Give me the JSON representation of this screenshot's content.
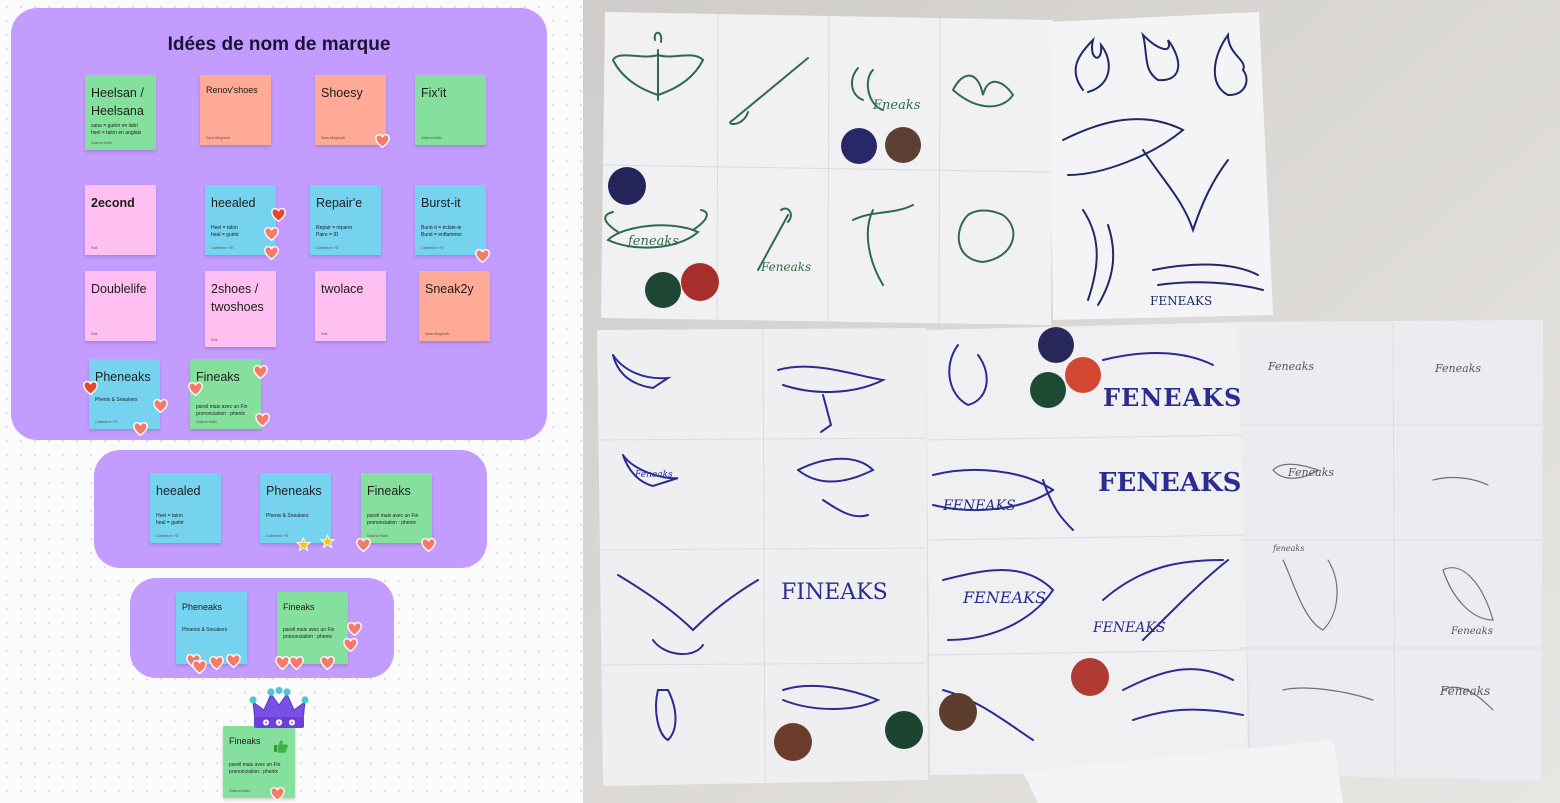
{
  "board": {
    "title": "Idées de nom de marque",
    "notes": [
      {
        "title": "Heelsan / Heelsana",
        "desc": "sana = guérir en latin\nheel = talon en anglais",
        "author": "Salima Mahi"
      },
      {
        "title": "Renov'shoes",
        "author": "Sara Meghreb"
      },
      {
        "title": "Shoesy",
        "author": "Sara Meghreb"
      },
      {
        "title": "Fix'it",
        "author": "Salima Mahi"
      },
      {
        "title": "2econd",
        "author": "Soli"
      },
      {
        "title": "heealed",
        "desc": "Heel = talon\nheal = guérir",
        "author": "Catherine YE"
      },
      {
        "title": "Repair'e",
        "desc": "Repair = réparer\nPaire = ID",
        "author": "Catherine YE"
      },
      {
        "title": "Burst-it",
        "desc": "Burst-it = éclate-le\nBurst = enflammer",
        "author": "Catherine YE"
      },
      {
        "title": "Doublelife",
        "author": "Soli"
      },
      {
        "title": "2shoes / twoshoes",
        "author": "Soli"
      },
      {
        "title": "twolace",
        "author": "Soli"
      },
      {
        "title": "Sneak2y",
        "author": "Sara Meghreb"
      },
      {
        "title": "Pheneaks",
        "desc": "Phenix & Sneakers",
        "author": "Catherine YE"
      },
      {
        "title": "Fineaks",
        "desc": "pareil mais avec un Fin prononciation : phenix",
        "author": "Salima Mahi"
      }
    ],
    "finalists": [
      {
        "title": "heealed",
        "desc": "Heel = talon\nheal = guérir",
        "author": "Catherine YE"
      },
      {
        "title": "Pheneaks",
        "desc": "Phenix & Sneakers",
        "author": "Catherine YE"
      },
      {
        "title": "Fineaks",
        "desc": "pareil mais avec un Fin prononciation : phenix",
        "author": "Salima Mahi"
      }
    ],
    "top2": [
      {
        "title": "Pheneaks",
        "desc": "Phoenix & Sneakers"
      },
      {
        "title": "Fineaks",
        "desc": "pareil mais avec un Fin prononciation : phenix"
      }
    ],
    "winner": {
      "title": "Fineaks",
      "desc": "pareil mais avec un Fin prononciation : phenix",
      "author": "Salima Mahi"
    }
  },
  "photo": {
    "sketch_words": [
      "feneaks",
      "Feneaks",
      "Fneaks",
      "FENEAKS",
      "FENEAKS",
      "FENEAKS",
      "FENEAKS",
      "FENEAKS",
      "FENEAKS",
      "Feneaks",
      "Feneaks",
      "Feneaks",
      "feneaks",
      "Feneaks",
      "FINEAKS",
      "Feneaks",
      "Feneaks"
    ]
  },
  "colors": {
    "section": "#c39cff",
    "green": "#86e09d",
    "orange": "#ffa997",
    "pink": "#ffbff0",
    "cyan": "#76d3ef",
    "heart": "#f47a6a",
    "heart_active": "#e5472f",
    "star": "#f3c51a"
  }
}
